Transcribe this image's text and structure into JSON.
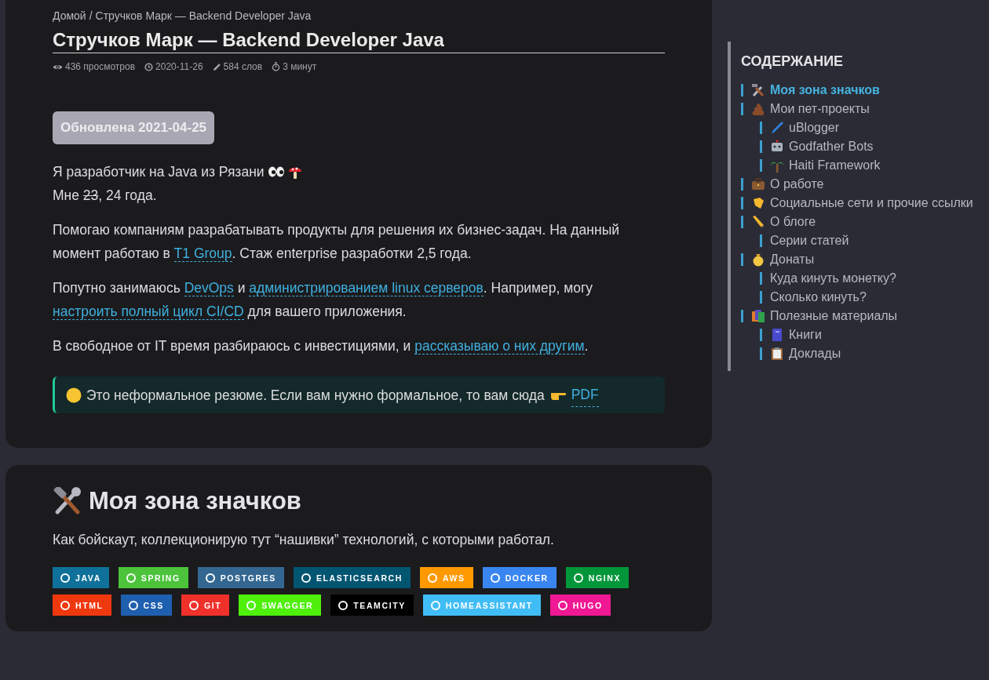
{
  "breadcrumb": {
    "home": "Домой",
    "separator": "/",
    "current": "Стручков Марк — Backend Developer Java"
  },
  "title": "Стручков Марк — Backend Developer Java",
  "meta": [
    {
      "kind": "views",
      "text": "436 просмотров"
    },
    {
      "kind": "date",
      "text": "2020-11-26"
    },
    {
      "kind": "words",
      "text": "584 слов"
    },
    {
      "kind": "time",
      "text": "3 минут"
    }
  ],
  "updated_badge": "Обновлена 2021-04-25",
  "intro": "Я разработчик на Java из Рязани",
  "age": {
    "before": "Мне ",
    "struck": "23",
    "after": ", 24 года."
  },
  "paragraphs": [
    [
      {
        "text": "Помогаю компаниям разрабатывать продукты для решения их бизнес-задач. На данный момент работаю в "
      },
      {
        "link": "T1 Group"
      },
      {
        "text": ". Стаж enterprise разработки 2,5 года."
      }
    ],
    [
      {
        "text": "Попутно занимаюсь "
      },
      {
        "link": "DevOps"
      },
      {
        "text": " и "
      },
      {
        "link": "администрированием linux серверов"
      },
      {
        "text": ". Например, могу "
      },
      {
        "link": "настроить полный цикл CI/CD"
      },
      {
        "text": " для вашего приложения."
      }
    ],
    [
      {
        "text": "В свободное от IT время разбираюсь с инвестициями, и "
      },
      {
        "link": "рассказываю о них другим"
      },
      {
        "text": "."
      }
    ]
  ],
  "callout": {
    "text": "Это неформальное резюме. Если вам нужно формальное, то вам сюда",
    "link": "PDF"
  },
  "section": {
    "heading": "Моя зона значков",
    "text": "Как бойскаут, коллекционирую тут “нашивки” технологий, с которыми работал."
  },
  "badges": [
    {
      "label": "JAVA",
      "color": "#0f7199"
    },
    {
      "label": "SPRING",
      "color": "#4cc33b"
    },
    {
      "label": "POSTGRES",
      "color": "#336791"
    },
    {
      "label": "ELASTICSEARCH",
      "color": "#005571"
    },
    {
      "label": "AWS",
      "color": "#ff9900"
    },
    {
      "label": "DOCKER",
      "color": "#3a86f0"
    },
    {
      "label": "NGINX",
      "color": "#009639"
    },
    {
      "label": "HTML",
      "color": "#f0380f"
    },
    {
      "label": "CSS",
      "color": "#1f5fb0"
    },
    {
      "label": "GIT",
      "color": "#f0302a"
    },
    {
      "label": "SWAGGER",
      "color": "#4ef00c"
    },
    {
      "label": "TEAMCITY",
      "color": "#000000"
    },
    {
      "label": "HOMEASSISTANT",
      "color": "#41bdf5"
    },
    {
      "label": "HUGO",
      "color": "#f01893"
    }
  ],
  "toc": {
    "title": "СОДЕРЖАНИЕ",
    "items": [
      {
        "label": "Моя зона значков",
        "selected": true
      },
      {
        "label": "Мои пет-проекты",
        "selected": false,
        "children": [
          {
            "label": "uBlogger",
            "selected": false
          },
          {
            "label": "Godfather Bots",
            "selected": false
          },
          {
            "label": "Haiti Framework",
            "selected": false
          }
        ]
      },
      {
        "label": "О работе",
        "selected": false
      },
      {
        "label": "Социальные сети и прочие ссылки",
        "selected": false
      },
      {
        "label": "О блоге",
        "selected": false,
        "children": [
          {
            "label": "Серии статей",
            "selected": false
          }
        ]
      },
      {
        "label": "Донаты",
        "selected": false,
        "children": [
          {
            "label": "Куда кинуть монетку?",
            "selected": false
          },
          {
            "label": "Сколько кинуть?",
            "selected": false
          }
        ]
      },
      {
        "label": "Полезные материалы",
        "selected": false,
        "children": [
          {
            "label": "Книги",
            "selected": false
          },
          {
            "label": "Доклады",
            "selected": false
          }
        ]
      }
    ]
  }
}
